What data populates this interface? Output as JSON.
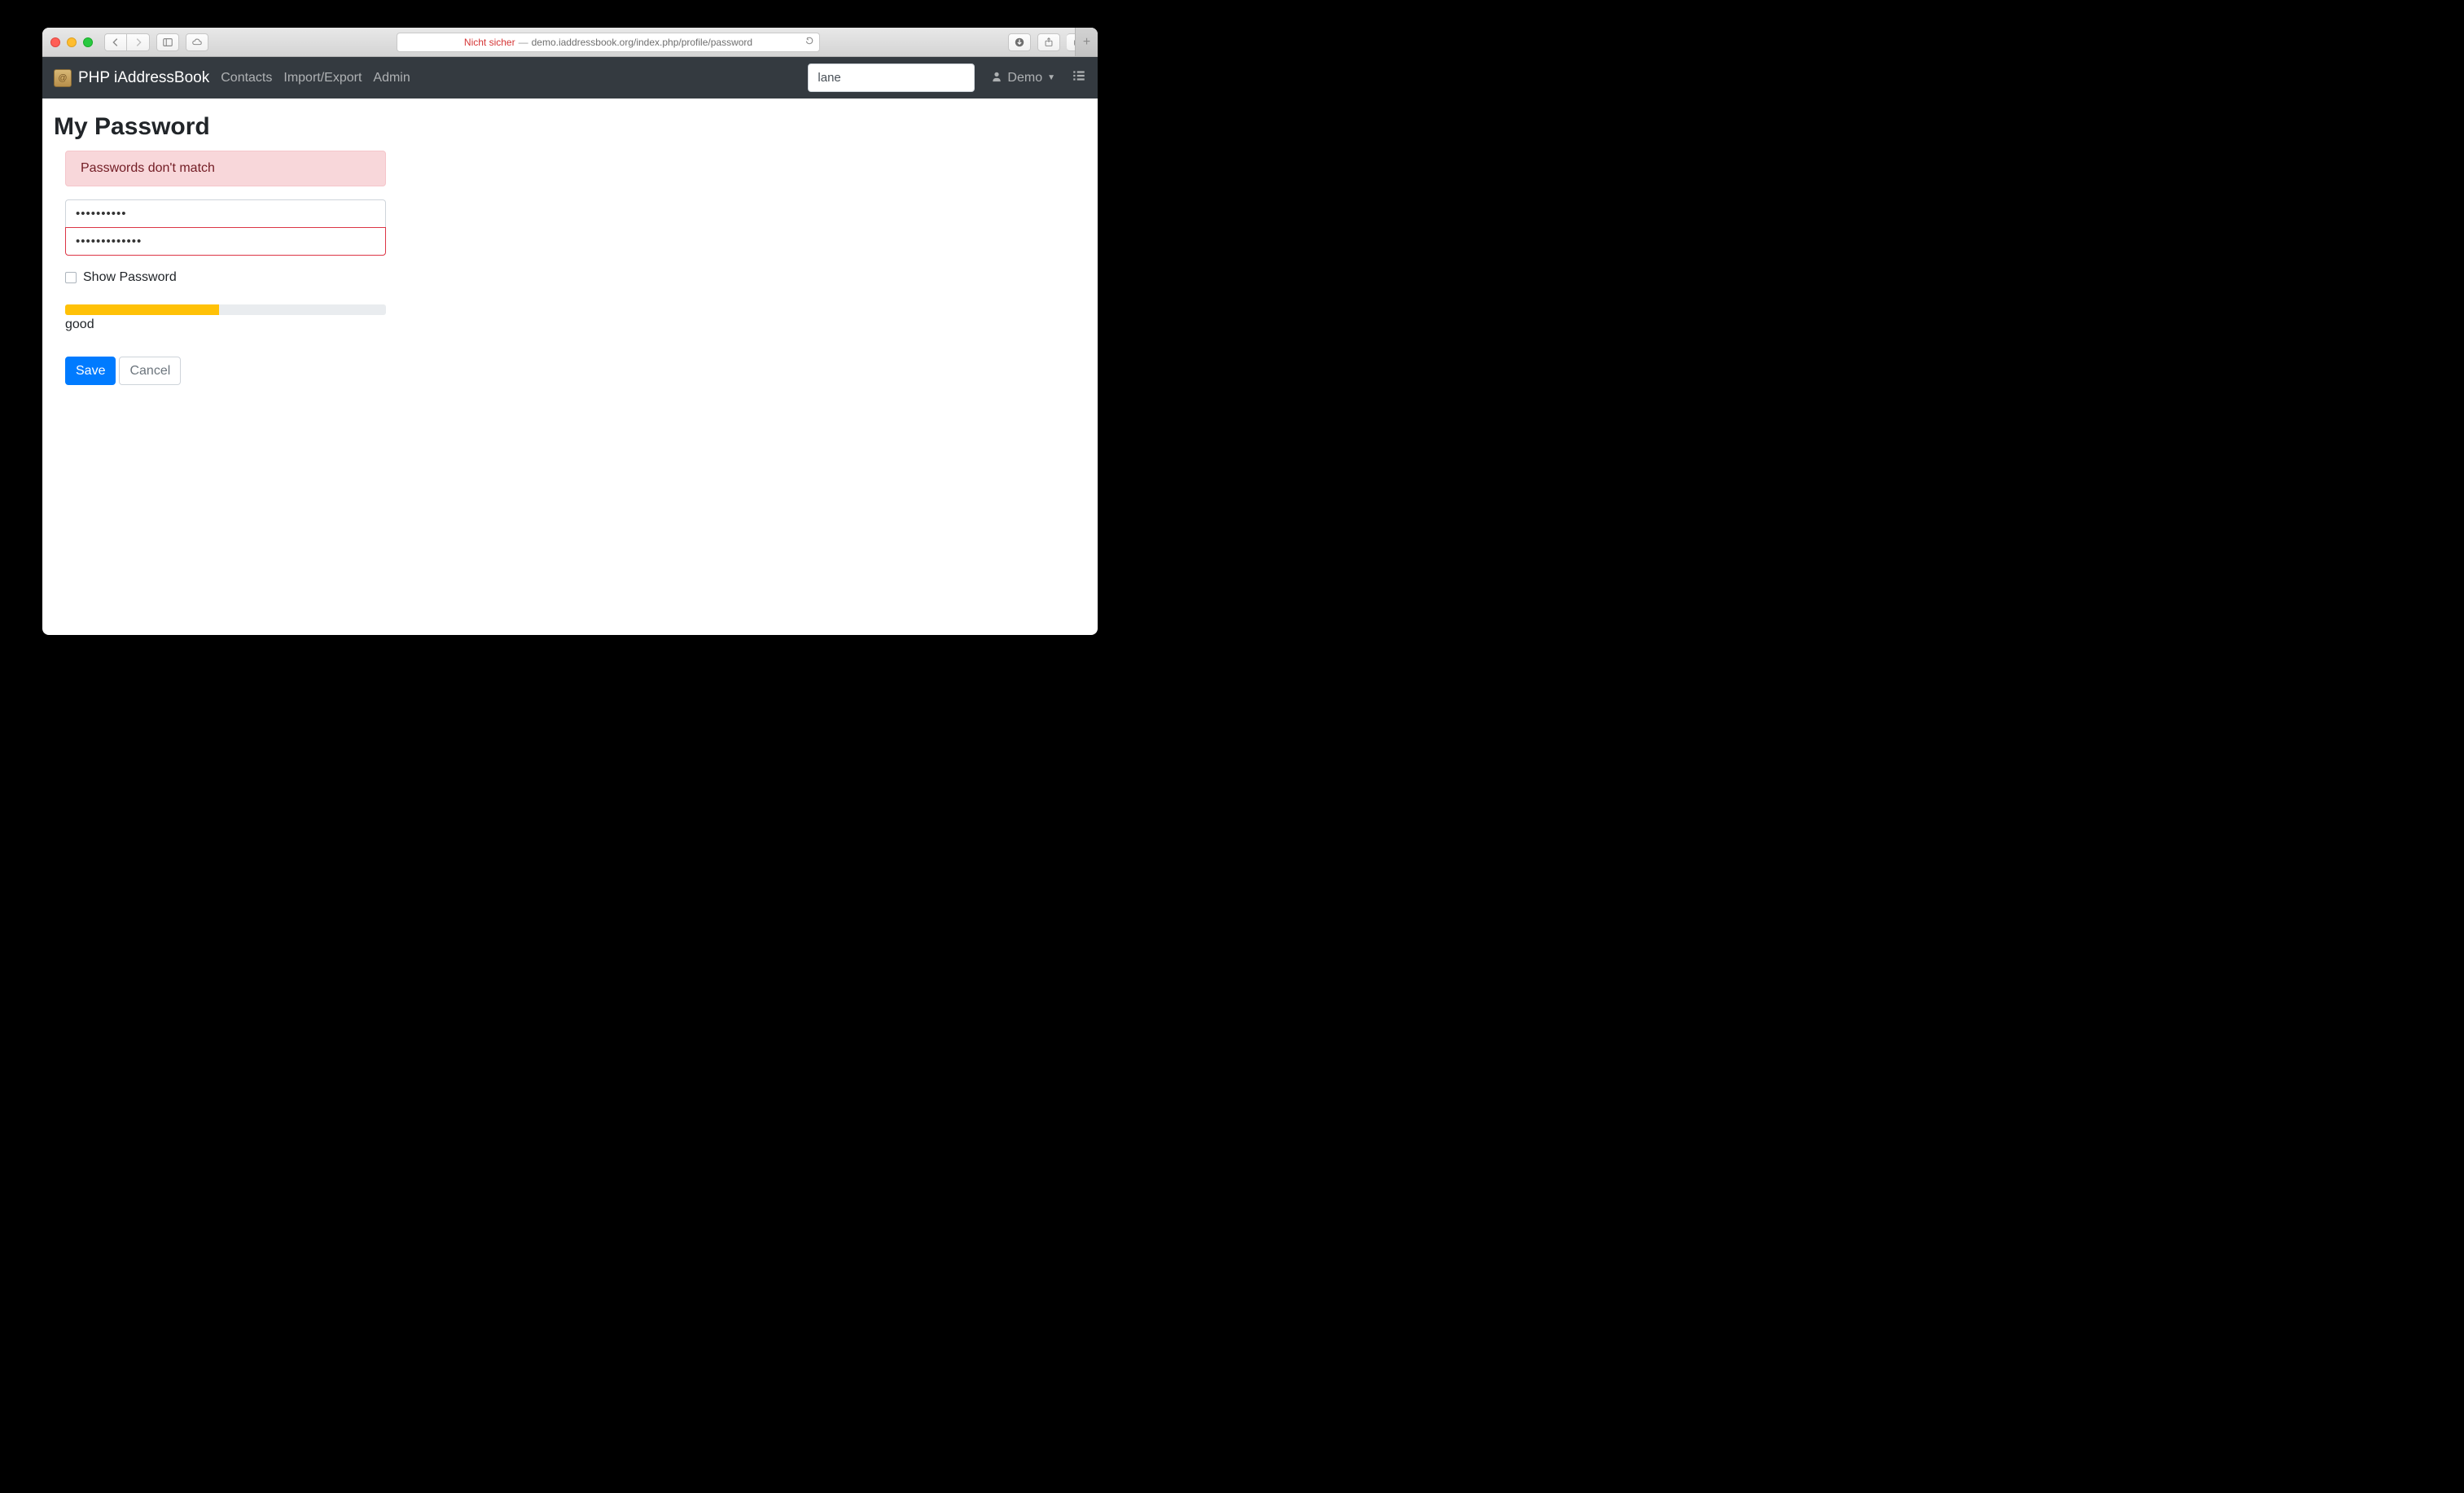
{
  "titlebar": {
    "secure_label": "Nicht sicher",
    "url": "demo.iaddressbook.org/index.php/profile/password"
  },
  "navbar": {
    "brand": "PHP iAddressBook",
    "links": [
      "Contacts",
      "Import/Export",
      "Admin"
    ],
    "search_value": "lane",
    "user": "Demo"
  },
  "page": {
    "title": "My Password",
    "error": "Passwords don't match",
    "password1": "••••••••••",
    "password2": "•••••••••••••",
    "show_password_label": "Show Password",
    "strength_percent": 48,
    "strength_label": "good",
    "save_label": "Save",
    "cancel_label": "Cancel"
  }
}
